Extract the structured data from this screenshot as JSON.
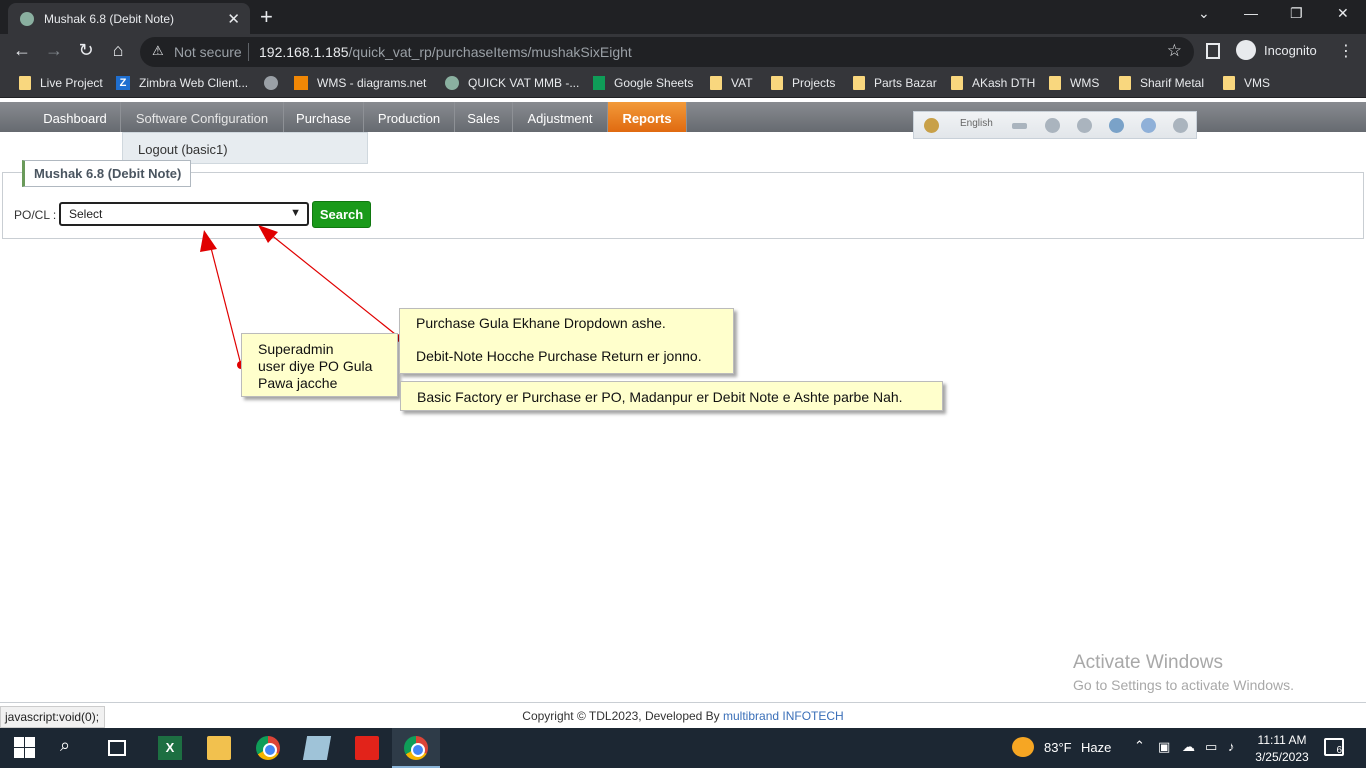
{
  "browser": {
    "tab_title": "Mushak 6.8 (Debit Note)",
    "tab_close": "✕",
    "new_tab": "+",
    "not_secure": "Not secure",
    "url_host": "192.168.1.185",
    "url_path": "/quick_vat_rp/purchaseItems/mushakSixEight",
    "profile": "Incognito"
  },
  "bookmarks": [
    "Live Project",
    "Zimbra Web Client...",
    "WMS - diagrams.net",
    "QUICK VAT MMB -...",
    "Google Sheets",
    "VAT",
    "Projects",
    "Parts Bazar",
    "AKash DTH",
    "WMS",
    "Sharif Metal",
    "VMS"
  ],
  "nav": {
    "dashboard": "Dashboard",
    "software_config": "Software Configuration",
    "purchase": "Purchase",
    "production": "Production",
    "sales": "Sales",
    "adjustment": "Adjustment",
    "reports": "Reports"
  },
  "tools": {
    "language": "English"
  },
  "dropdown": {
    "logout": "Logout (basic1)"
  },
  "panel": {
    "title": "Mushak 6.8 (Debit Note)",
    "po_label": "PO/CL :",
    "select_value": "Select",
    "search_button": "Search"
  },
  "annotations": {
    "superadmin": [
      "Superadmin",
      "user diye PO Gula",
      "Pawa jacche"
    ],
    "dropdown_note_1": "Purchase Gula Ekhane Dropdown ashe.",
    "dropdown_note_2": "Debit-Note Hocche Purchase Return er jonno.",
    "factory_note": "Basic Factory er Purchase er PO, Madanpur er Debit Note e Ashte parbe Nah."
  },
  "watermark": {
    "line1": "Activate Windows",
    "line2": "Go to Settings to activate Windows."
  },
  "footer": {
    "copyright": "Copyright © TDL2023, Developed By ",
    "link": "multibrand INFOTECH"
  },
  "status_url": "javascript:void(0);",
  "taskbar": {
    "temperature": "83°F",
    "weather": "Haze",
    "time": "11:11 AM",
    "date": "3/25/2023",
    "notifications": "6"
  },
  "colors": {
    "reports_active": "#e06a10",
    "search_button": "#1a9a1a",
    "callout_bg": "#ffffcc",
    "arrow": "#e00000"
  }
}
